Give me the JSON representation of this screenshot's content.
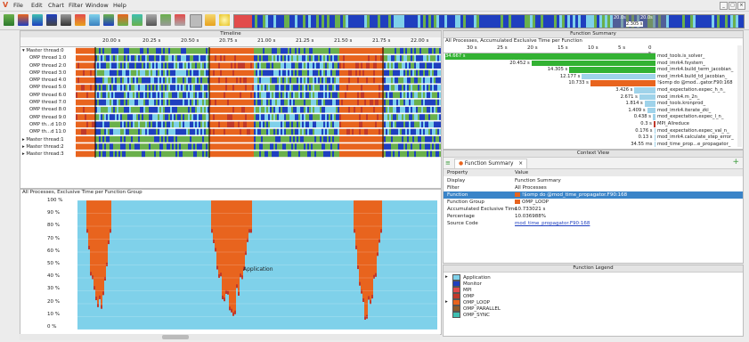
{
  "menu": {
    "file": "File",
    "edit": "Edit",
    "chart": "Chart",
    "filter": "Filter",
    "window": "Window",
    "help": "Help"
  },
  "timeline": {
    "title": "Timeline",
    "ticks": [
      "20.00 s",
      "20.25 s",
      "20.50 s",
      "20.75 s",
      "21.00 s",
      "21.25 s",
      "21.50 s",
      "21.75 s",
      "22.00 s"
    ],
    "rows": [
      "Master thread:0",
      "OMP thread 1:0",
      "OMP thread 2:0",
      "OMP thread 3:0",
      "OMP thread 4:0",
      "OMP thread 5:0",
      "OMP thread 6:0",
      "OMP thread 7:0",
      "OMP thread 8:0",
      "OMP thread 9:0",
      "OMP th...d 10:0",
      "OMP th...d 11:0",
      "Master thread:1",
      "Master thread:2",
      "Master thread:3"
    ],
    "overview_labels": [
      "20.0s",
      "20.0s",
      "2.305 s"
    ]
  },
  "function_group": {
    "title": "All Processes, Exclusive Time per Function Group",
    "yticks": [
      "100 %",
      "90 %",
      "80 %",
      "70 %",
      "60 %",
      "50 %",
      "40 %",
      "30 %",
      "20 %",
      "10 %",
      "0 %"
    ],
    "annotation": "Application"
  },
  "function_summary": {
    "title": "Function Summary",
    "subtitle": "All Processes, Accumulated Exclusive Time per Function",
    "scale": [
      "30 s",
      "25 s",
      "20 s",
      "15 s",
      "10 s",
      "5 s",
      "0 s"
    ],
    "items": [
      {
        "value": "34.667 s",
        "name": "mod_tools.is_solver_",
        "frac": 1.0,
        "color": "#33b233"
      },
      {
        "value": "20.452 s",
        "name": "mod_imrk4.fsystem_",
        "frac": 0.59,
        "color": "#33b233"
      },
      {
        "value": "14.305 s",
        "name": "mod_imrk4.build_term_jacobian_",
        "frac": 0.41,
        "color": "#33b233"
      },
      {
        "value": "12.177 s",
        "name": "mod_imrk4.build_td_jacobian_",
        "frac": 0.35,
        "color": "#9fd3ea"
      },
      {
        "value": "10.733 s",
        "name": "!$omp do @mod...gator.F90:168",
        "frac": 0.31,
        "color": "#e8641e"
      },
      {
        "value": "3.426 s",
        "name": "mod_expectation.expec_h_n_",
        "frac": 0.1,
        "color": "#9fd3ea"
      },
      {
        "value": "2.671 s",
        "name": "mod_imrk4.m_2n_",
        "frac": 0.077,
        "color": "#9fd3ea"
      },
      {
        "value": "1.814 s",
        "name": "mod_tools.kronprod_",
        "frac": 0.052,
        "color": "#9fd3ea"
      },
      {
        "value": "1.409 s",
        "name": "mod_imrk4.iterate_zki_",
        "frac": 0.04,
        "color": "#9fd3ea"
      },
      {
        "value": "0.438 s",
        "name": "mod_expectation.expec_l_n_",
        "frac": 0.013,
        "color": "#9fd3ea"
      },
      {
        "value": "0.3 s",
        "name": "MPI_Allreduce",
        "frac": 0.009,
        "color": "#c0392b"
      },
      {
        "value": "0.176 s",
        "name": "mod_expectation.expec_val_n_",
        "frac": 0.005,
        "color": "#9fd3ea"
      },
      {
        "value": "0.13 s",
        "name": "mod_imrk4.calculate_step_error_",
        "frac": 0.004,
        "color": "#9fd3ea"
      },
      {
        "value": "34.55 ms",
        "name": "mod_time_prop...e_propagator_",
        "frac": 0.001,
        "color": "#9fd3ea"
      }
    ]
  },
  "context": {
    "title": "Context View",
    "tab": "Function Summary",
    "header": {
      "k": "Property",
      "v": "Value"
    },
    "rows": [
      {
        "k": "Display",
        "v": "Function Summary"
      },
      {
        "k": "Filter",
        "v": "All Processes"
      },
      {
        "k": "Function",
        "v": "!$omp do @mod_time_propagator.F90:168",
        "selected": true,
        "color": "#e8641e"
      },
      {
        "k": "Function Group",
        "v": "OMP_LOOP",
        "color": "#e8641e"
      },
      {
        "k": "Accumulated Exclusive Time",
        "v": "10.733021 s"
      },
      {
        "k": "Percentage",
        "v": "10.036988%"
      },
      {
        "k": "Source Code",
        "v": "mod_time_propagator.F90:168",
        "link": true
      }
    ]
  },
  "legend": {
    "title": "Function Legend",
    "items": [
      {
        "name": "Application",
        "color": "#7fd1ea"
      },
      {
        "name": "Monitor",
        "color": "#1f3fbf"
      },
      {
        "name": "MPI",
        "color": "#e24b4b"
      },
      {
        "name": "OMP",
        "color": "#c0392b"
      },
      {
        "name": "OMP_LOOP",
        "color": "#e8641e"
      },
      {
        "name": "OMP_PARALLEL",
        "color": "#8b5a2b"
      },
      {
        "name": "OMP_SYNC",
        "color": "#3fbfb0"
      }
    ]
  }
}
